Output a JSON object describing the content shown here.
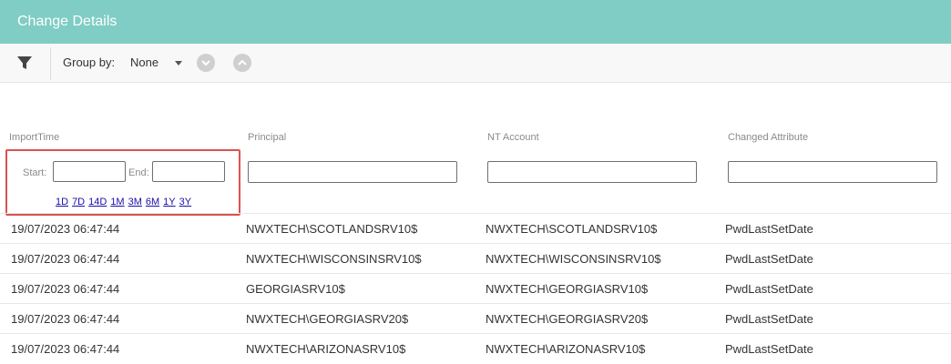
{
  "window": {
    "title": "Change Details"
  },
  "toolbar": {
    "group_by_label": "Group by:",
    "group_by_value": "None"
  },
  "columns": {
    "import_time": "ImportTime",
    "principal": "Principal",
    "nt_account": "NT Account",
    "changed_attribute": "Changed Attribute"
  },
  "filters": {
    "start_label": "Start:",
    "end_label": "End:",
    "start_value": "",
    "end_value": "",
    "principal_value": "",
    "nt_account_value": "",
    "changed_attribute_value": "",
    "quick_ranges": [
      "1D",
      "7D",
      "14D",
      "1M",
      "3M",
      "6M",
      "1Y",
      "3Y"
    ]
  },
  "rows": [
    {
      "import_time": "19/07/2023 06:47:44",
      "principal": "NWXTECH\\SCOTLANDSRV10$",
      "nt_account": "NWXTECH\\SCOTLANDSRV10$",
      "changed_attribute": "PwdLastSetDate"
    },
    {
      "import_time": "19/07/2023 06:47:44",
      "principal": "NWXTECH\\WISCONSINSRV10$",
      "nt_account": "NWXTECH\\WISCONSINSRV10$",
      "changed_attribute": "PwdLastSetDate"
    },
    {
      "import_time": "19/07/2023 06:47:44",
      "principal": "GEORGIASRV10$",
      "nt_account": "NWXTECH\\GEORGIASRV10$",
      "changed_attribute": "PwdLastSetDate"
    },
    {
      "import_time": "19/07/2023 06:47:44",
      "principal": "NWXTECH\\GEORGIASRV20$",
      "nt_account": "NWXTECH\\GEORGIASRV20$",
      "changed_attribute": "PwdLastSetDate"
    },
    {
      "import_time": "19/07/2023 06:47:44",
      "principal": "NWXTECH\\ARIZONASRV10$",
      "nt_account": "NWXTECH\\ARIZONASRV10$",
      "changed_attribute": "PwdLastSetDate"
    }
  ],
  "colors": {
    "titlebar": "#7fcdc4",
    "highlight_border": "#d9534f",
    "link": "#1a0dab"
  }
}
